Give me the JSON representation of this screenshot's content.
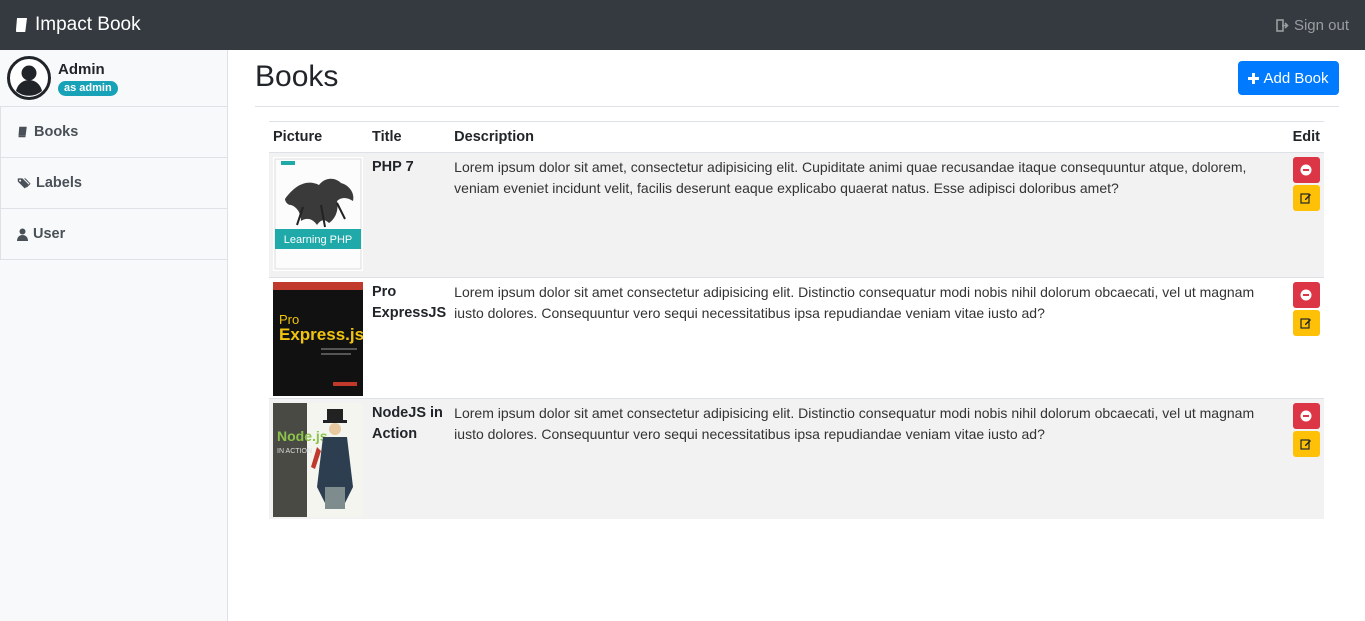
{
  "navbar": {
    "brand": "Impact Book",
    "signout": "Sign out"
  },
  "sidebar": {
    "user_name": "Admin",
    "role_badge": "as admin",
    "items": [
      {
        "label": "Books",
        "icon": "book-icon"
      },
      {
        "label": "Labels",
        "icon": "tags-icon"
      },
      {
        "label": "User",
        "icon": "user-icon"
      }
    ]
  },
  "main": {
    "title": "Books",
    "add_button": "Add Book",
    "table": {
      "headers": [
        "Picture",
        "Title",
        "Description",
        "Edit"
      ],
      "rows": [
        {
          "title": "PHP 7",
          "description": "Lorem ipsum dolor sit amet, consectetur adipisicing elit. Cupiditate animi quae recusandae itaque consequuntur atque, dolorem, veniam eveniet incidunt velit, facilis deserunt eaque explicabo quaerat natus. Esse adipisci doloribus amet?",
          "cover_text": "Learning PHP"
        },
        {
          "title": "Pro ExpressJS",
          "description": "Lorem ipsum dolor sit amet consectetur adipisicing elit. Distinctio consequatur modi nobis nihil dolorum obcaecati, vel ut magnam iusto dolores. Consequuntur vero sequi necessitatibus ipsa repudiandae veniam vitae iusto ad?",
          "cover_text_top": "Pro",
          "cover_text_bottom": "Express.js"
        },
        {
          "title": "NodeJS in Action",
          "description": "Lorem ipsum dolor sit amet consectetur adipisicing elit. Distinctio consequatur modi nobis nihil dolorum obcaecati, vel ut magnam iusto dolores. Consequuntur vero sequi necessitatibus ipsa repudiandae veniam vitae iusto ad?",
          "cover_text_top": "Node.js",
          "cover_text_bottom": "IN ACTION"
        }
      ]
    }
  },
  "colors": {
    "navbar": "#343a40",
    "primary": "#007bff",
    "danger": "#dc3545",
    "warning": "#ffc107",
    "info": "#17a2b8"
  }
}
